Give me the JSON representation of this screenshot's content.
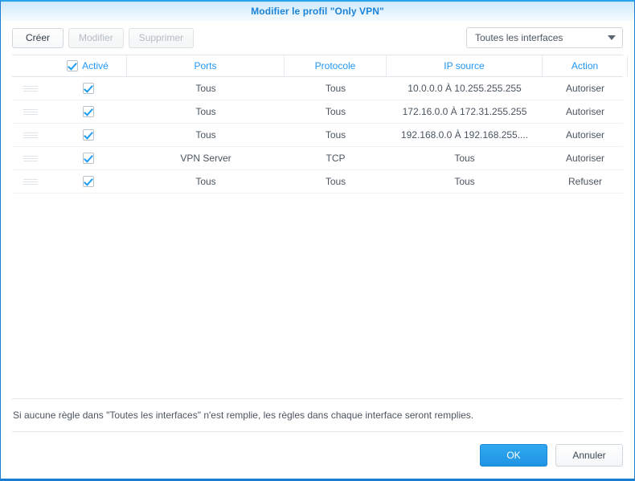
{
  "dialog": {
    "title": "Modifier le profil \"Only VPN\"",
    "accent_color": "#1b84d8"
  },
  "toolbar": {
    "create_label": "Créer",
    "edit_label": "Modifier",
    "delete_label": "Supprimer",
    "interface_selected": "Toutes les interfaces",
    "dropdown_icon": "chevron-down-icon"
  },
  "grid": {
    "columns": [
      {
        "key": "handle",
        "label": ""
      },
      {
        "key": "enabled",
        "label": "Activé"
      },
      {
        "key": "ports",
        "label": "Ports"
      },
      {
        "key": "protocol",
        "label": "Protocole"
      },
      {
        "key": "ip_source",
        "label": "IP source"
      },
      {
        "key": "action",
        "label": "Action"
      }
    ],
    "header_checkbox_checked": true,
    "rows": [
      {
        "enabled": true,
        "ports": "Tous",
        "protocol": "Tous",
        "ip_source": "10.0.0.0 À 10.255.255.255",
        "action": "Autoriser"
      },
      {
        "enabled": true,
        "ports": "Tous",
        "protocol": "Tous",
        "ip_source": "172.16.0.0 À 172.31.255.255",
        "action": "Autoriser"
      },
      {
        "enabled": true,
        "ports": "Tous",
        "protocol": "Tous",
        "ip_source": "192.168.0.0 À 192.168.255....",
        "action": "Autoriser"
      },
      {
        "enabled": true,
        "ports": "VPN Server",
        "protocol": "TCP",
        "ip_source": "Tous",
        "action": "Autoriser"
      },
      {
        "enabled": true,
        "ports": "Tous",
        "protocol": "Tous",
        "ip_source": "Tous",
        "action": "Refuser"
      }
    ]
  },
  "note": "Si aucune règle dans \"Toutes les interfaces\" n'est remplie, les règles dans chaque interface seront remplies.",
  "footer": {
    "ok_label": "OK",
    "cancel_label": "Annuler"
  }
}
